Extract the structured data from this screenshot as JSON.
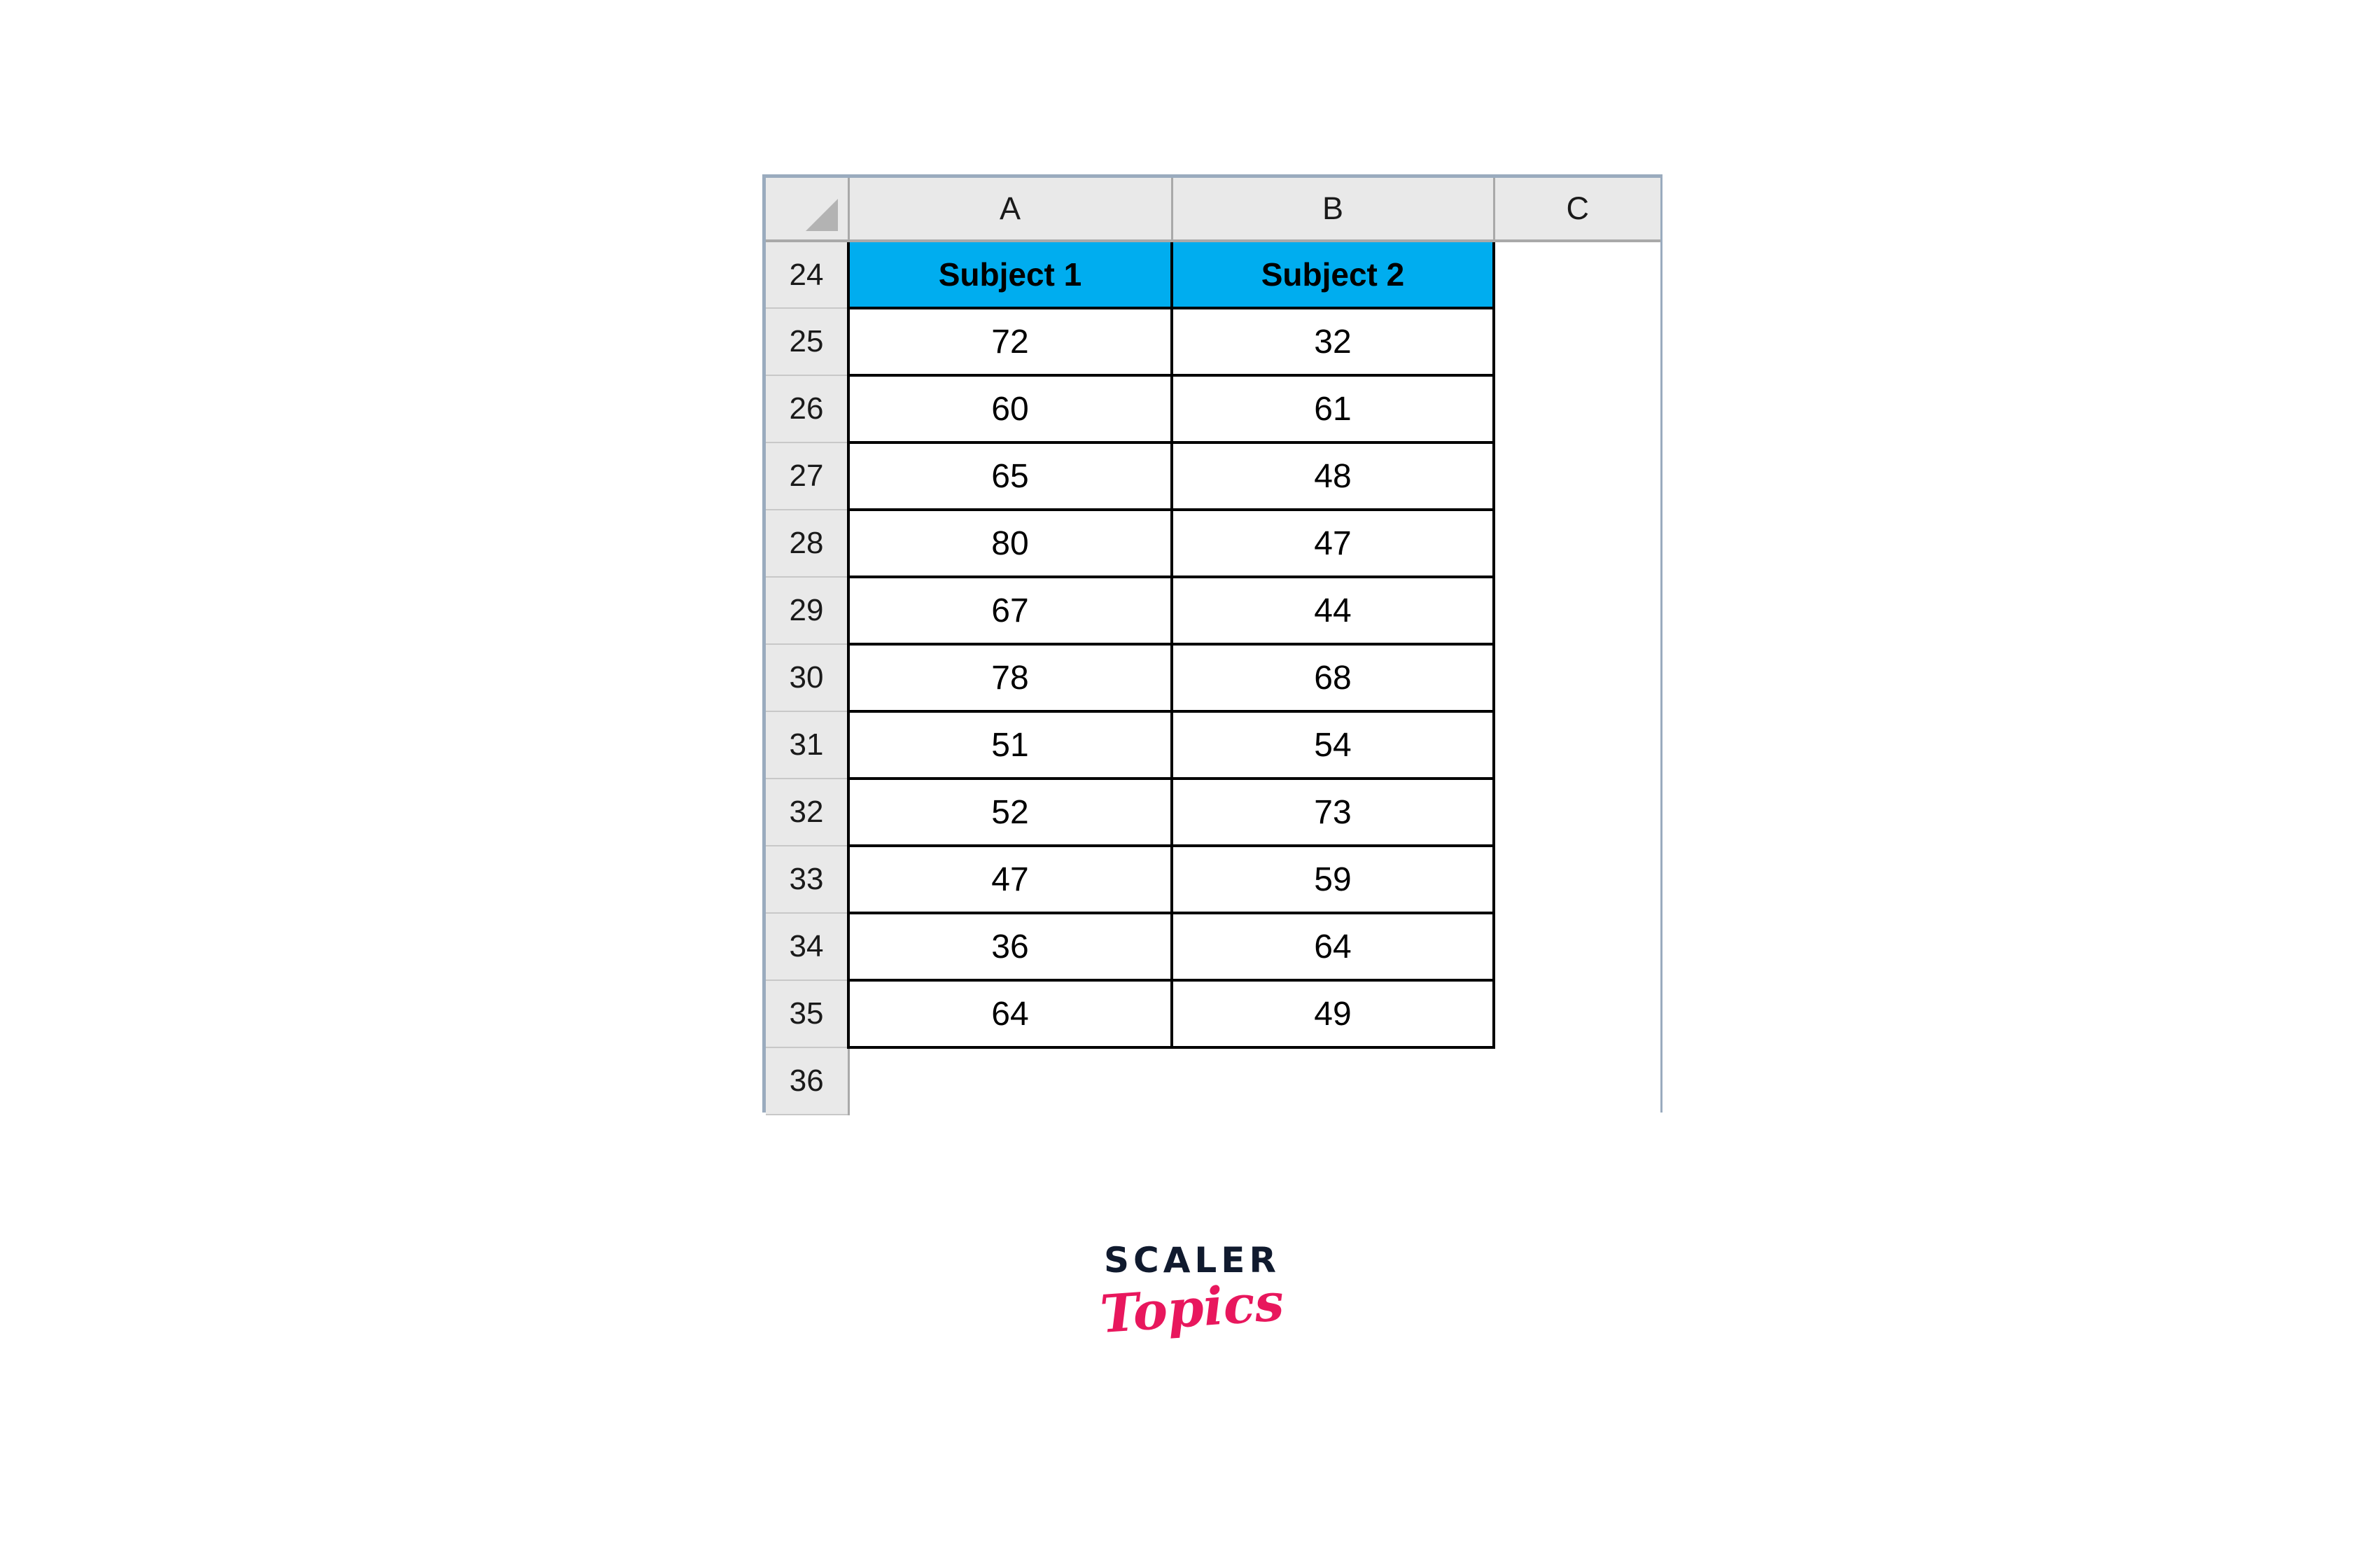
{
  "spreadsheet": {
    "corner_icon": "select-all-triangle-icon",
    "column_headers": [
      "A",
      "B",
      "C"
    ],
    "row_headers": [
      "24",
      "25",
      "26",
      "27",
      "28",
      "29",
      "30",
      "31",
      "32",
      "33",
      "34",
      "35",
      "36"
    ],
    "header_row": {
      "row_number": "24",
      "cells": [
        "Subject 1",
        "Subject 2"
      ]
    },
    "data_rows": [
      {
        "row_number": "25",
        "a": "72",
        "b": "32"
      },
      {
        "row_number": "26",
        "a": "60",
        "b": "61"
      },
      {
        "row_number": "27",
        "a": "65",
        "b": "48"
      },
      {
        "row_number": "28",
        "a": "80",
        "b": "47"
      },
      {
        "row_number": "29",
        "a": "67",
        "b": "44"
      },
      {
        "row_number": "30",
        "a": "78",
        "b": "68"
      },
      {
        "row_number": "31",
        "a": "51",
        "b": "54"
      },
      {
        "row_number": "32",
        "a": "52",
        "b": "73"
      },
      {
        "row_number": "33",
        "a": "47",
        "b": "59"
      },
      {
        "row_number": "34",
        "a": "36",
        "b": "64"
      },
      {
        "row_number": "35",
        "a": "64",
        "b": "49"
      }
    ],
    "empty_row": {
      "row_number": "36",
      "a": "",
      "b": "",
      "c": ""
    },
    "colors": {
      "header_fill": "#00ADEF",
      "header_band": "#E9E9E9",
      "grid_border": "#000000",
      "panel_border": "#9AABBE",
      "row_head_divider": "#A9A9A9"
    }
  },
  "logo": {
    "primary": "SCALER",
    "secondary": "Topics",
    "primary_color": "#101A2E",
    "secondary_color": "#E8175D"
  },
  "chart_data": {
    "type": "table",
    "title": "Subject 1 / Subject 2 score table",
    "columns": [
      "Subject 1",
      "Subject 2"
    ],
    "row_labels": [
      "25",
      "26",
      "27",
      "28",
      "29",
      "30",
      "31",
      "32",
      "33",
      "34",
      "35"
    ],
    "series": [
      {
        "name": "Subject 1",
        "values": [
          72,
          60,
          65,
          80,
          67,
          78,
          51,
          52,
          47,
          36,
          64
        ]
      },
      {
        "name": "Subject 2",
        "values": [
          32,
          61,
          48,
          47,
          44,
          68,
          54,
          73,
          59,
          64,
          49
        ]
      }
    ]
  }
}
